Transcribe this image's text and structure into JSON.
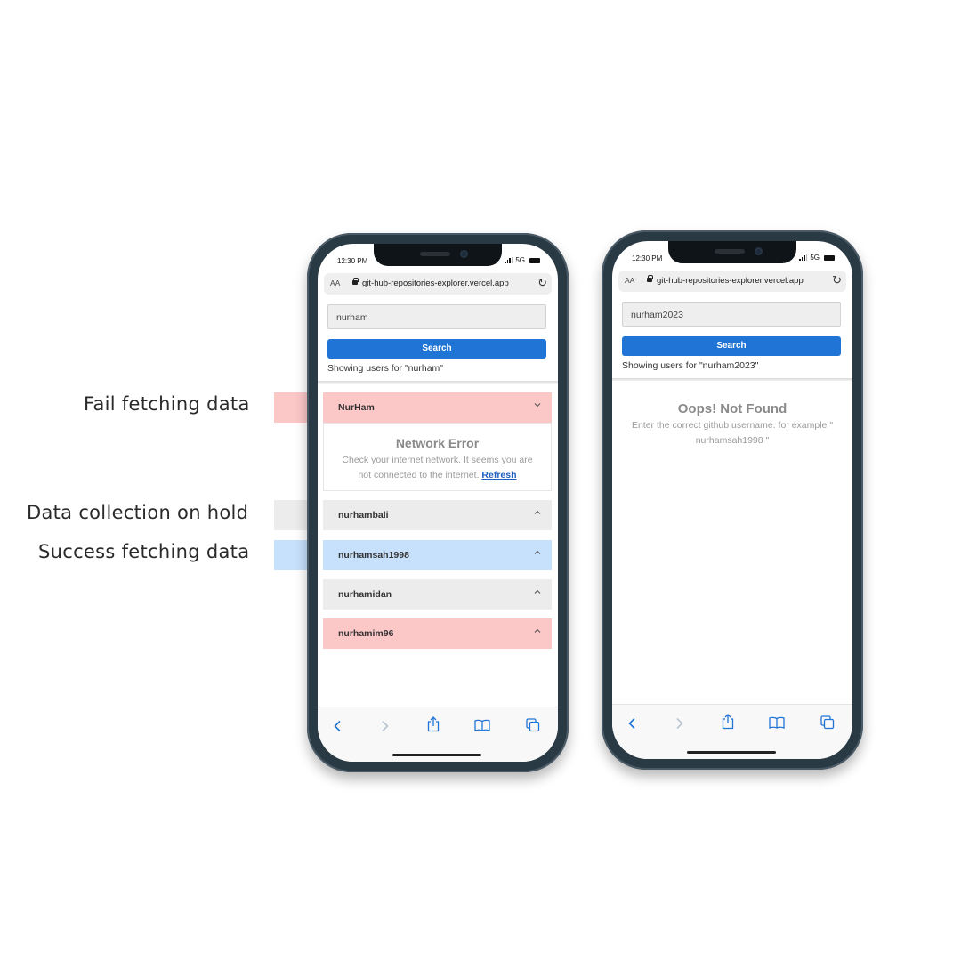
{
  "annotations": [
    {
      "label": "Fail fetching data",
      "color": "#fcc7c7"
    },
    {
      "label": "Data collection on hold",
      "color": "#ececec"
    },
    {
      "label": "Success fetching data",
      "color": "#c7e1fc"
    }
  ],
  "status_bar": {
    "time": "12:30 PM",
    "network": "5G"
  },
  "browser": {
    "aa_label": "AA",
    "url": "git-hub-repositories-explorer.vercel.app"
  },
  "search_button_label": "Search",
  "phone_left": {
    "search_value": "nurham",
    "showing_text": "Showing users for \"nurham\"",
    "users": [
      {
        "name": "NurHam",
        "state": "fail",
        "expanded": true
      },
      {
        "name": "nurhambali",
        "state": "hold",
        "expanded": false
      },
      {
        "name": "nurhamsah1998",
        "state": "success",
        "expanded": false
      },
      {
        "name": "nurhamidan",
        "state": "hold",
        "expanded": false
      },
      {
        "name": "nurhamim96",
        "state": "fail",
        "expanded": false
      }
    ],
    "error": {
      "title": "Network Error",
      "message_line1": "Check your internet network. It seems you are",
      "message_line2": "not connected to the internet.",
      "refresh_label": "Refresh"
    }
  },
  "phone_right": {
    "search_value": "nurham2023",
    "showing_text": "Showing users for \"nurham2023\"",
    "not_found": {
      "title": "Oops! Not Found",
      "message_line1": "Enter the correct github username. for example \"",
      "message_line2": "nurhamsah1998 \""
    }
  },
  "toolbar_icons": [
    "back-icon",
    "forward-icon",
    "share-icon",
    "bookmarks-icon",
    "tabs-icon"
  ]
}
